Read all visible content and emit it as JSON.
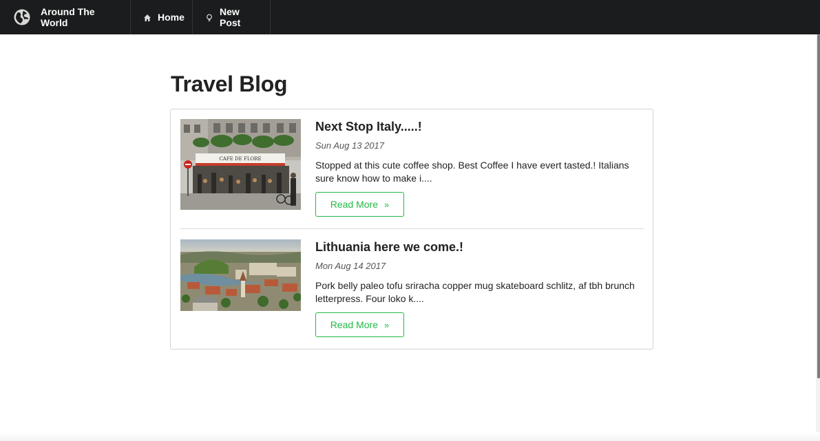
{
  "nav": {
    "brand": "Around The World",
    "items": [
      {
        "label": "Home",
        "icon": "home-icon"
      },
      {
        "label": "New Post",
        "icon": "lightbulb-icon"
      }
    ]
  },
  "page": {
    "title": "Travel Blog"
  },
  "posts": [
    {
      "title": "Next Stop Italy.....!",
      "date": "Sun Aug 13 2017",
      "excerpt": "Stopped at this cute coffee shop. Best Coffee I have evert tasted.! Italians sure know how to make i....",
      "button": "Read More",
      "image": "cafe-photo",
      "sign_text": "CAFE DE FLORE"
    },
    {
      "title": "Lithuania here we come.!",
      "date": "Mon Aug 14 2017",
      "excerpt": "Pork belly paleo tofu sriracha copper mug skateboard schlitz, af tbh brunch letterpress. Four loko k....",
      "button": "Read More",
      "image": "city-aerial-photo"
    }
  ],
  "colors": {
    "navbar": "#1b1c1d",
    "accent": "#21ba45",
    "text": "#222222"
  }
}
